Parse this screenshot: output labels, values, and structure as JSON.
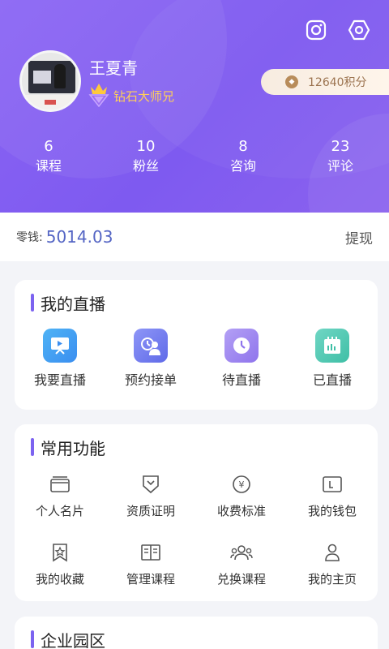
{
  "profile": {
    "name": "王夏青",
    "level": "钻石大师兄",
    "points": "12640积分"
  },
  "stats": [
    {
      "value": "6",
      "label": "课程"
    },
    {
      "value": "10",
      "label": "粉丝"
    },
    {
      "value": "8",
      "label": "咨询"
    },
    {
      "value": "23",
      "label": "评论"
    }
  ],
  "balance": {
    "label": "零钱:",
    "value": "5014.03",
    "withdraw": "提现"
  },
  "live": {
    "title": "我的直播",
    "items": [
      {
        "label": "我要直播",
        "icon": "live-broadcast-icon"
      },
      {
        "label": "预约接单",
        "icon": "booking-icon"
      },
      {
        "label": "待直播",
        "icon": "clock-icon"
      },
      {
        "label": "已直播",
        "icon": "calendar-icon"
      }
    ]
  },
  "functions": {
    "title": "常用功能",
    "items": [
      {
        "label": "个人名片",
        "icon": "card-icon"
      },
      {
        "label": "资质证明",
        "icon": "certificate-icon"
      },
      {
        "label": "收费标准",
        "icon": "yen-icon"
      },
      {
        "label": "我的钱包",
        "icon": "wallet-icon"
      },
      {
        "label": "我的收藏",
        "icon": "bookmark-star-icon"
      },
      {
        "label": "管理课程",
        "icon": "book-icon"
      },
      {
        "label": "兑换课程",
        "icon": "group-icon"
      },
      {
        "label": "我的主页",
        "icon": "user-icon"
      }
    ]
  },
  "enterprise": {
    "title": "企业园区"
  },
  "colors": {
    "header_purple": "#8a64f4",
    "accent_blue": "#5465c4",
    "gold": "#ffcf5a"
  }
}
